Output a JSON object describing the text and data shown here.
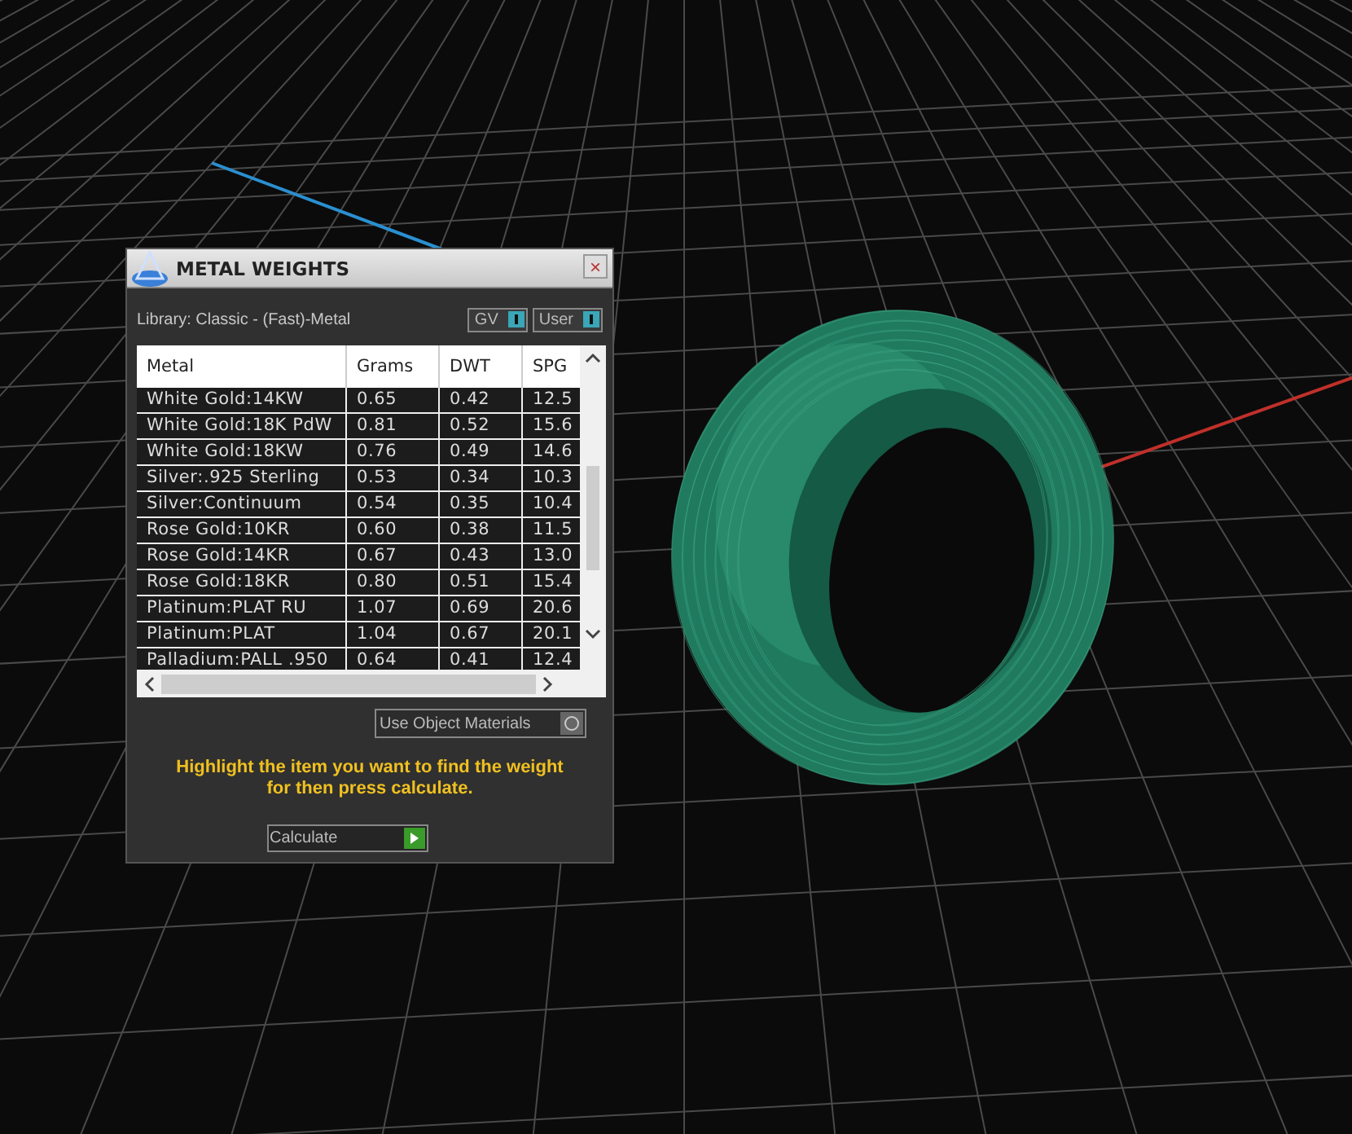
{
  "window": {
    "title": "METAL WEIGHTS",
    "close": "×"
  },
  "library": "Library: Classic - (Fast)-Metal",
  "toggles": [
    {
      "label": "GV"
    },
    {
      "label": "User"
    }
  ],
  "table": {
    "columns": [
      "Metal",
      "Grams",
      "DWT",
      "SPG"
    ],
    "rows": [
      [
        "White Gold:14KW",
        "0.65",
        "0.42",
        "12.5"
      ],
      [
        "White Gold:18K PdW",
        "0.81",
        "0.52",
        "15.6"
      ],
      [
        "White Gold:18KW",
        "0.76",
        "0.49",
        "14.6"
      ],
      [
        "Silver:.925 Sterling",
        "0.53",
        "0.34",
        "10.3"
      ],
      [
        "Silver:Continuum",
        "0.54",
        "0.35",
        "10.4"
      ],
      [
        "Rose Gold:10KR",
        "0.60",
        "0.38",
        "11.5"
      ],
      [
        "Rose Gold:14KR",
        "0.67",
        "0.43",
        "13.0"
      ],
      [
        "Rose Gold:18KR",
        "0.80",
        "0.51",
        "15.4"
      ],
      [
        "Platinum:PLAT RU",
        "1.07",
        "0.69",
        "20.6"
      ],
      [
        "Platinum:PLAT",
        "1.04",
        "0.67",
        "20.1"
      ],
      [
        "Palladium:PALL .950",
        "0.64",
        "0.41",
        "12.4"
      ]
    ]
  },
  "use_object_materials": "Use Object Materials",
  "hint": "Highlight the item you want to find the weight for then press calculate.",
  "calculate": "Calculate"
}
